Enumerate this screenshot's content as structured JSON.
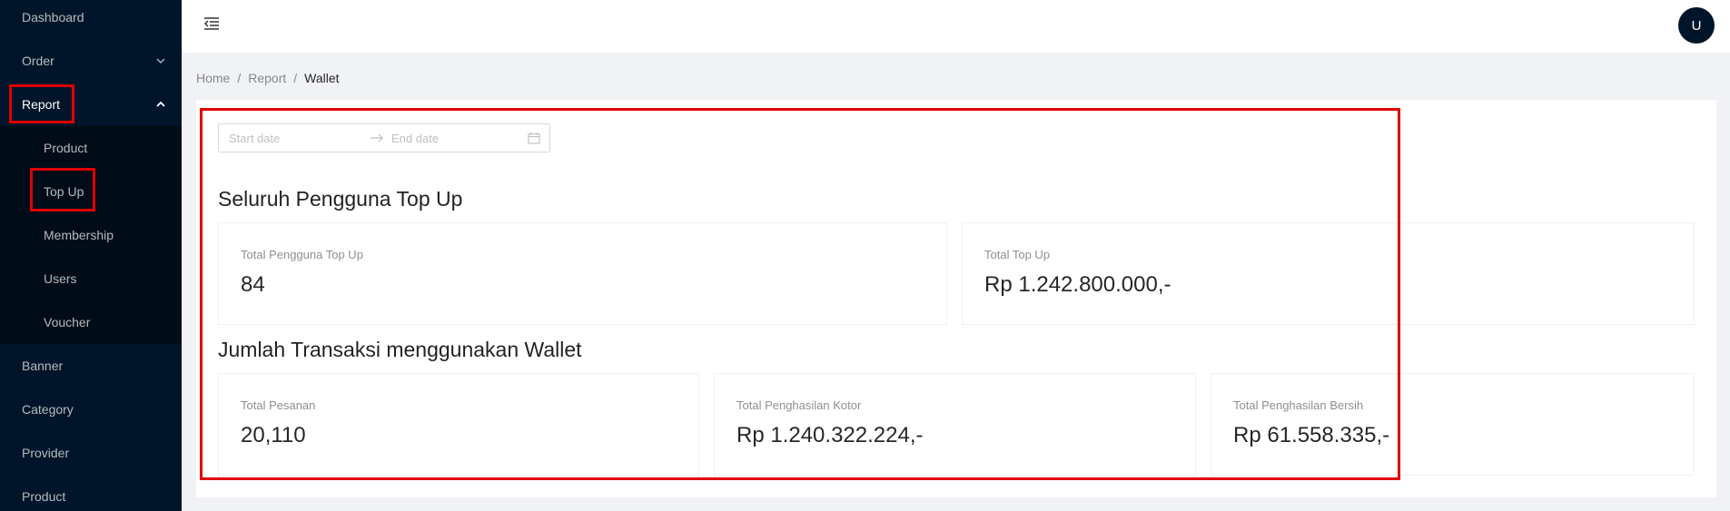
{
  "sidebar": {
    "items": [
      {
        "label": "Dashboard"
      },
      {
        "label": "Order"
      },
      {
        "label": "Report"
      },
      {
        "label": "Banner"
      },
      {
        "label": "Category"
      },
      {
        "label": "Provider"
      },
      {
        "label": "Product"
      }
    ],
    "report_sub": [
      {
        "label": "Product"
      },
      {
        "label": "Top Up"
      },
      {
        "label": "Membership"
      },
      {
        "label": "Users"
      },
      {
        "label": "Voucher"
      }
    ]
  },
  "header": {
    "avatar_initial": "U"
  },
  "breadcrumb": {
    "home": "Home",
    "sep1": "/",
    "report": "Report",
    "sep2": "/",
    "current": "Wallet"
  },
  "filter": {
    "start_placeholder": "Start date",
    "end_placeholder": "End date"
  },
  "section1": {
    "title": "Seluruh Pengguna Top Up",
    "stats": [
      {
        "label": "Total Pengguna Top Up",
        "value": "84"
      },
      {
        "label": "Total Top Up",
        "value": "Rp 1.242.800.000,-"
      }
    ]
  },
  "section2": {
    "title": "Jumlah Transaksi menggunakan Wallet",
    "stats": [
      {
        "label": "Total Pesanan",
        "value": "20,110"
      },
      {
        "label": "Total Penghasilan Kotor",
        "value": "Rp 1.240.322.224,-"
      },
      {
        "label": "Total Penghasilan Bersih",
        "value": "Rp 61.558.335,-"
      }
    ]
  },
  "colors": {
    "sidebar_bg": "#001529",
    "submenu_bg": "#000c17",
    "highlight": "#e00000"
  }
}
